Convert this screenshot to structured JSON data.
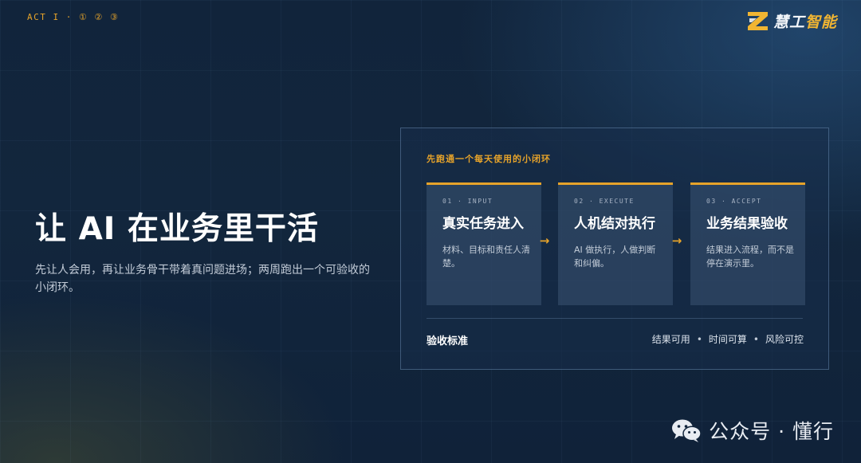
{
  "header": {
    "act_label": "ACT I · ① ② ③",
    "brand": {
      "name_main": "慧工",
      "name_accent": "智能",
      "icon": "z-logo-icon"
    }
  },
  "hero": {
    "title": "让 AI 在业务里干活",
    "subtitle": "先让人会用，再让业务骨干带着真问题进场；两周跑出一个可验收的小闭环。"
  },
  "panel": {
    "caption": "先跑通一个每天使用的小闭环",
    "steps": [
      {
        "code": "01 · INPUT",
        "title": "真实任务进入",
        "desc": "材料、目标和责任人清楚。"
      },
      {
        "code": "02 · EXECUTE",
        "title": "人机结对执行",
        "desc": "AI 做执行，人做判断和纠偏。"
      },
      {
        "code": "03 · ACCEPT",
        "title": "业务结果验收",
        "desc": "结果进入流程，而不是停在演示里。"
      }
    ],
    "arrow_icon": "arrow-right-icon",
    "criteria_label": "验收标准",
    "criteria": [
      "结果可用",
      "时间可算",
      "风险可控"
    ],
    "criteria_separator": "•"
  },
  "watermark": {
    "icon": "wechat-icon",
    "text": "公众号 · 懂行"
  },
  "colors": {
    "accent": "#e6a32a",
    "background": "#11243b",
    "panel_border": "#5f7ea3",
    "text_primary": "#ffffff"
  }
}
